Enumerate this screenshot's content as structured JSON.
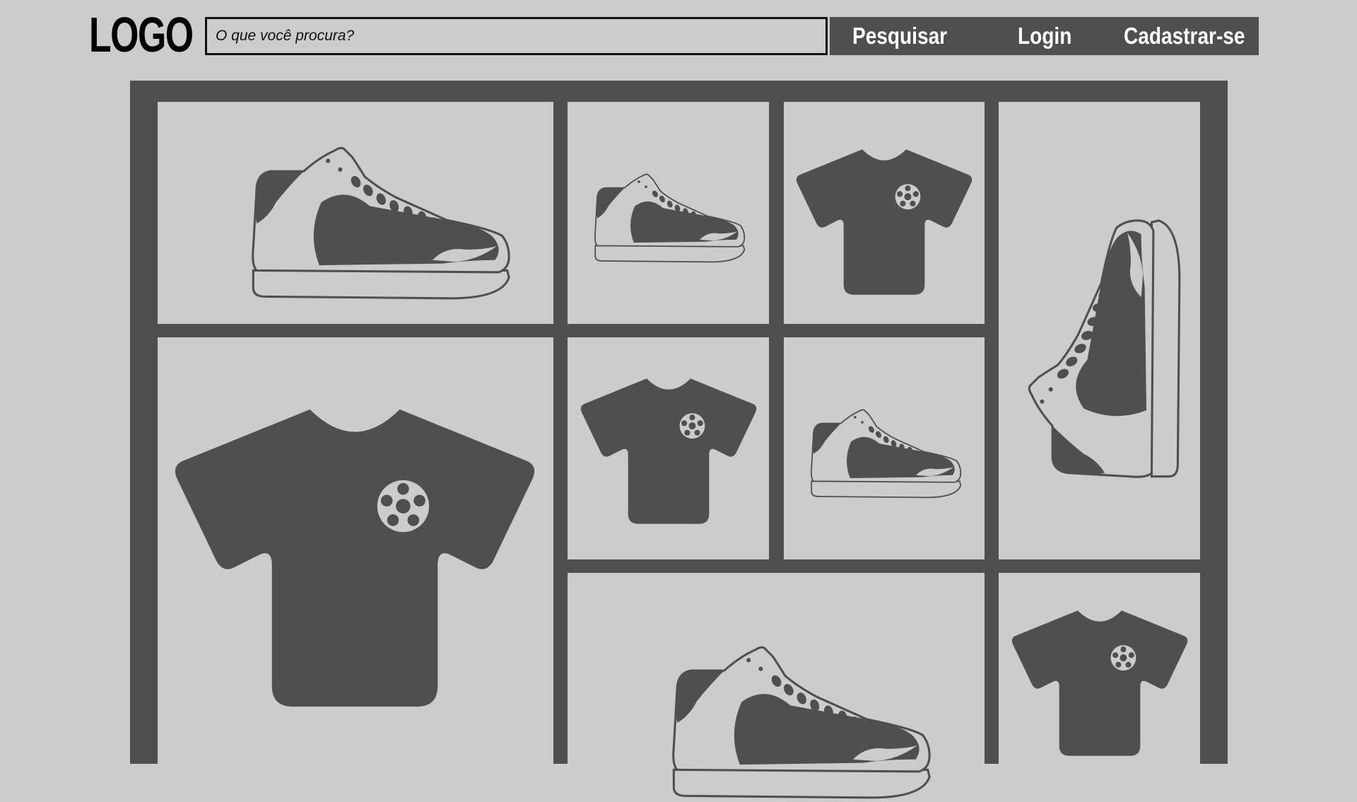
{
  "header": {
    "logo_text": "LOGO",
    "search": {
      "placeholder": "O que você procura?",
      "value": ""
    },
    "nav": {
      "search_label": "Pesquisar",
      "login_label": "Login",
      "signup_label": "Cadastrar-se"
    }
  },
  "colors": {
    "background": "#cccccc",
    "dark": "#4f4f4f",
    "text": "#000000",
    "nav_text": "#ffffff"
  },
  "products": [
    {
      "icon": "sneaker-icon"
    },
    {
      "icon": "sneaker-icon"
    },
    {
      "icon": "tshirt-icon"
    },
    {
      "icon": "sneaker-icon"
    },
    {
      "icon": "tshirt-icon"
    },
    {
      "icon": "tshirt-icon"
    },
    {
      "icon": "sneaker-icon"
    },
    {
      "icon": "sneaker-icon"
    },
    {
      "icon": "tshirt-icon"
    }
  ]
}
